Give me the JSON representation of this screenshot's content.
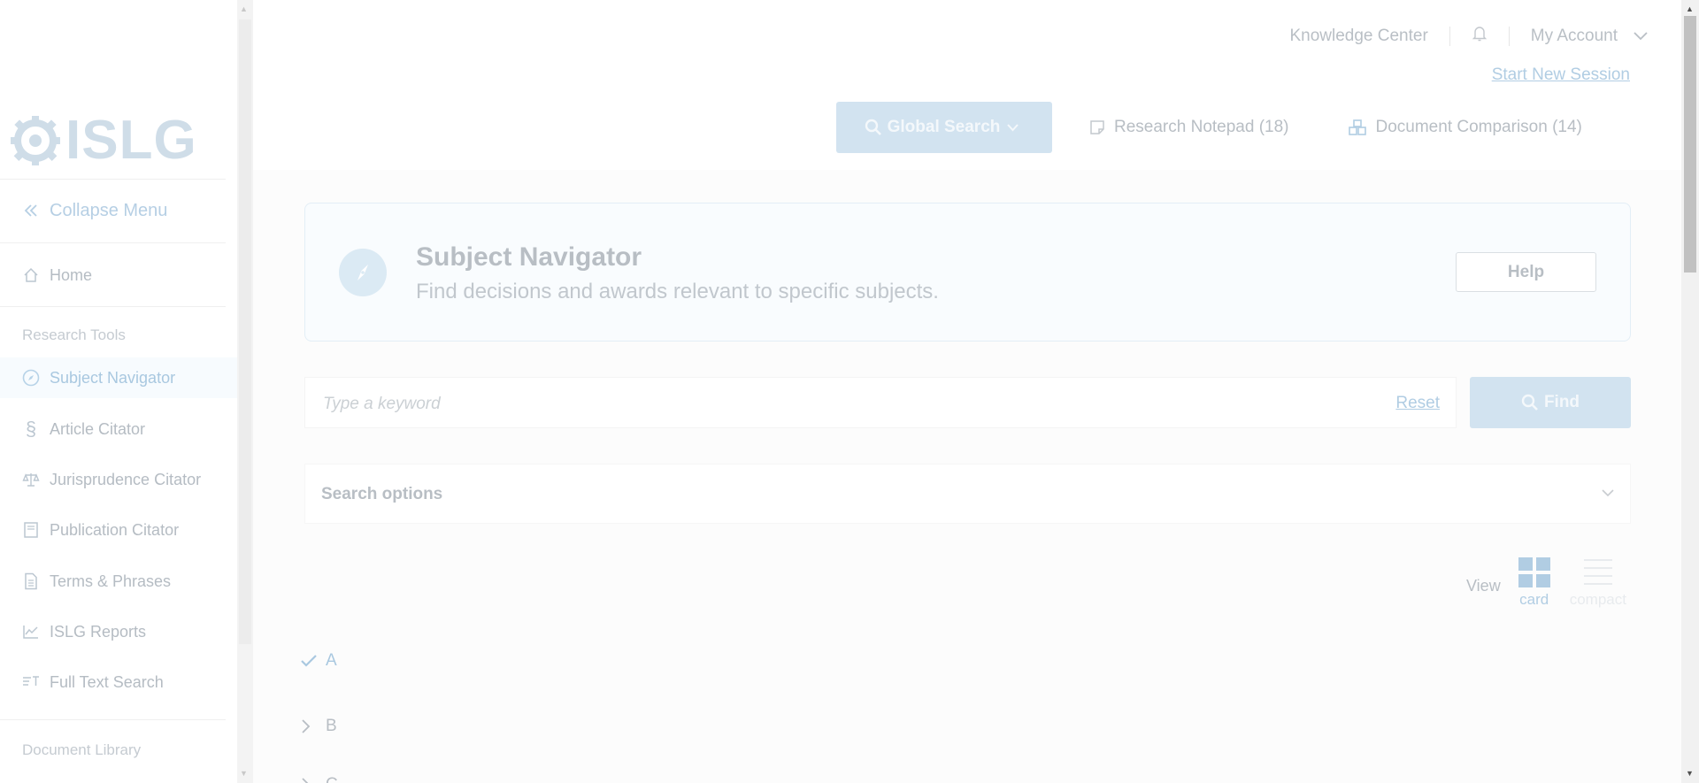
{
  "header": {
    "knowledge_center": "Knowledge Center",
    "account": "My Account",
    "start_session": "Start New Session",
    "global_search": "Global Search",
    "notepad": "Research Notepad (18)",
    "comparison": "Document Comparison (14)"
  },
  "sidebar": {
    "logo": "ISLG",
    "collapse": "Collapse Menu",
    "home": "Home",
    "section_tools": "Research Tools",
    "items": [
      {
        "label": "Subject Navigator",
        "icon": "compass-icon"
      },
      {
        "label": "Article Citator",
        "icon": "section-icon"
      },
      {
        "label": "Jurisprudence Citator",
        "icon": "scales-icon"
      },
      {
        "label": "Publication Citator",
        "icon": "book-icon"
      },
      {
        "label": "Terms & Phrases",
        "icon": "document-icon"
      },
      {
        "label": "ISLG Reports",
        "icon": "chart-icon"
      },
      {
        "label": "Full Text Search",
        "icon": "text-search-icon"
      }
    ],
    "section_library": "Document Library"
  },
  "hero": {
    "title": "Subject Navigator",
    "subtitle": "Find decisions and awards relevant to specific subjects.",
    "help": "Help"
  },
  "search": {
    "placeholder": "Type a keyword",
    "reset": "Reset",
    "find": "Find"
  },
  "options": {
    "label": "Search options"
  },
  "view": {
    "label": "View",
    "card": "card",
    "compact": "compact"
  },
  "letters": [
    "A",
    "B",
    "C"
  ],
  "colors": {
    "accent": "#b1cde3",
    "button_bg": "#d2e3f0",
    "muted_text": "#b8bec4"
  }
}
